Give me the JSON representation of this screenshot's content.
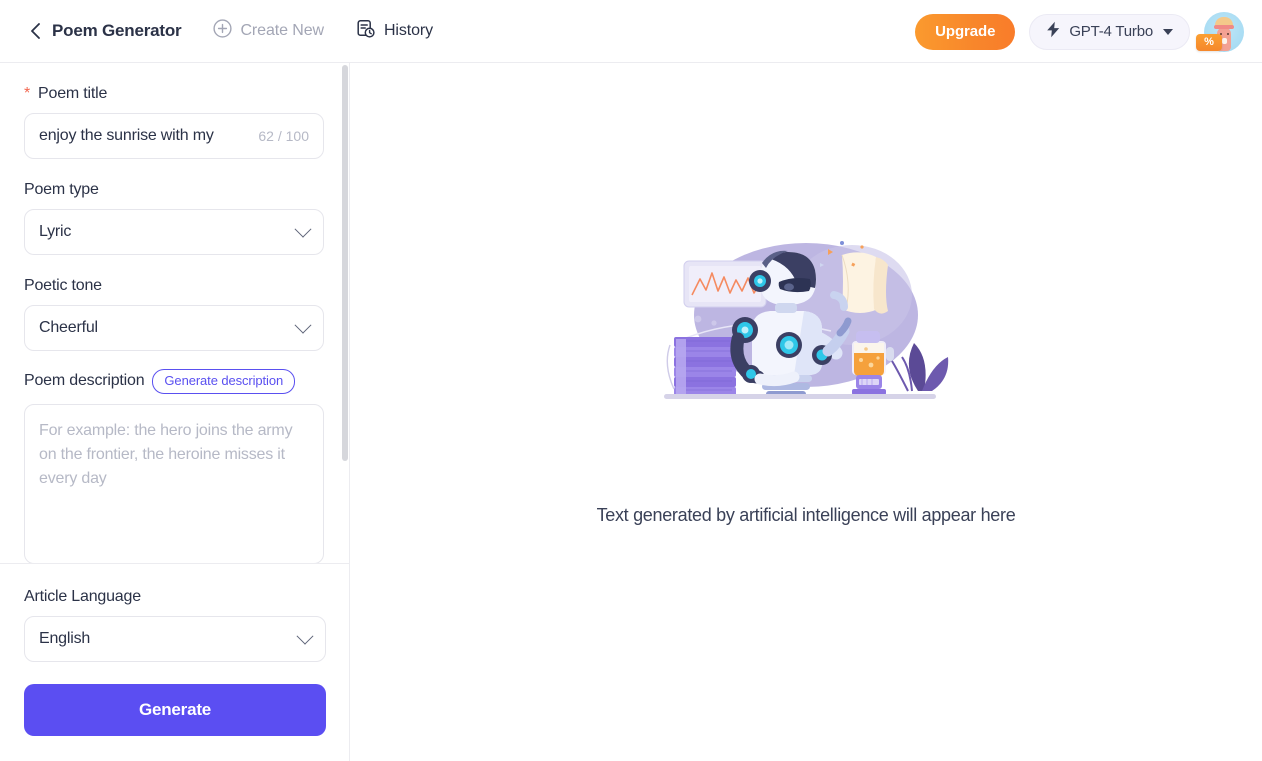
{
  "header": {
    "back_icon": "chevron-left-icon",
    "title": "Poem Generator",
    "create_new": {
      "label": "Create New",
      "icon": "plus-circle-icon"
    },
    "history": {
      "label": "History",
      "icon": "document-clock-icon"
    },
    "upgrade_label": "Upgrade",
    "model": {
      "label": "GPT-4 Turbo",
      "icon": "lightning-bolt-icon",
      "caret": "caret-down-icon"
    },
    "avatar": {
      "name": "user-avatar",
      "badge": "%"
    }
  },
  "sidebar": {
    "poem_title": {
      "label": "Poem title",
      "required_marker": "*",
      "value": "enjoy the sunrise with my",
      "counter": "62 / 100"
    },
    "poem_type": {
      "label": "Poem type",
      "value": "Lyric"
    },
    "poetic_tone": {
      "label": "Poetic tone",
      "value": "Cheerful"
    },
    "poem_description": {
      "label": "Poem description",
      "generate_badge": "Generate description",
      "placeholder": "For example: the hero joins the army on the frontier, the heroine misses it every day"
    },
    "article_language": {
      "label": "Article Language",
      "value": "English"
    },
    "generate_button": "Generate"
  },
  "main": {
    "illustration": "robot-writing-illustration",
    "empty_text": "Text generated by artificial intelligence will appear here"
  },
  "colors": {
    "accent_purple": "#5b4ef2",
    "upgrade_orange": "#f8862b",
    "required_red": "#f2664f",
    "text_dark": "#2b3247",
    "text_muted": "#b6b9c6",
    "border": "#e6e6ec"
  }
}
